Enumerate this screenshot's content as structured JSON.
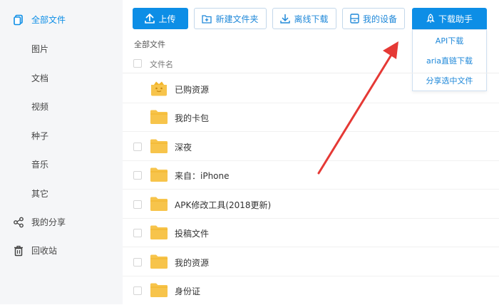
{
  "sidebar": {
    "all_files": "全部文件",
    "categories": [
      "图片",
      "文档",
      "视频",
      "种子",
      "音乐",
      "其它"
    ],
    "my_share": "我的分享",
    "recycle_bin": "回收站"
  },
  "toolbar": {
    "upload": "上传",
    "new_folder": "新建文件夹",
    "offline_download": "离线下载",
    "my_devices": "我的设备",
    "download_helper": "下载助手"
  },
  "dropdown": {
    "items": [
      "API下载",
      "aria直链下载",
      "分享选中文件"
    ]
  },
  "breadcrumb": "全部文件",
  "file_list": {
    "column_name": "文件名",
    "files": [
      {
        "name": "已购资源",
        "icon": "purchased-folder-icon"
      },
      {
        "name": "我的卡包",
        "icon": "folder-icon"
      },
      {
        "name": "深夜",
        "icon": "folder-icon"
      },
      {
        "name": "来自：iPhone",
        "icon": "folder-icon"
      },
      {
        "name": "APK修改工具(2018更新)",
        "icon": "folder-icon"
      },
      {
        "name": "投稿文件",
        "icon": "folder-icon"
      },
      {
        "name": "我的资源",
        "icon": "folder-icon"
      },
      {
        "name": "身份证",
        "icon": "folder-icon"
      }
    ]
  },
  "colors": {
    "accent": "#0d8ee6",
    "folder": "#f7c44b",
    "arrow": "#e53935",
    "sidebar_bg": "#f5f6f8"
  }
}
